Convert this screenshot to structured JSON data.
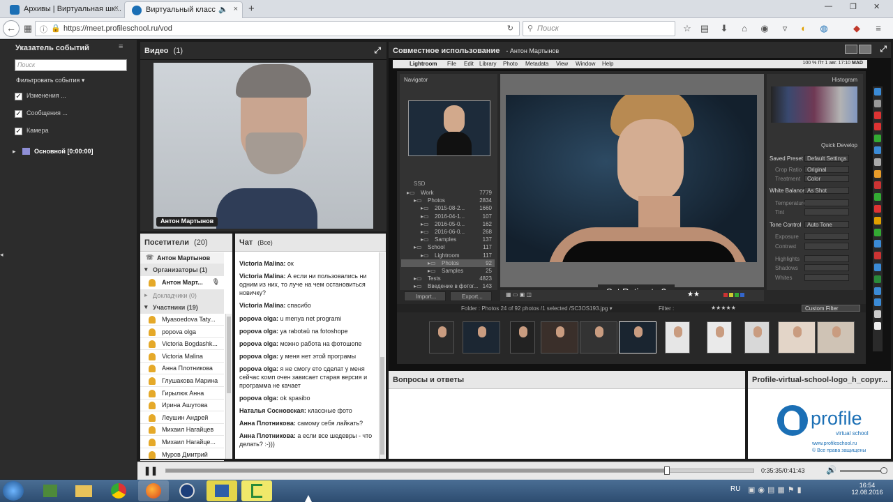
{
  "browser": {
    "tabs": [
      {
        "title": "Архивы | Виртуальная шк...",
        "close": "×"
      },
      {
        "title": "Виртуальный класс",
        "close": "×"
      }
    ],
    "new_tab": "+",
    "url": "https://meet.profileschool.ru/vod",
    "search_placeholder": "Поиск",
    "window_controls": [
      "—",
      "❐",
      "✕"
    ]
  },
  "left_panel": {
    "title": "Указатель событий",
    "menu": "≡",
    "search_placeholder": "Поиск",
    "filter_label": "Фильтровать события",
    "filters": [
      {
        "label": "Изменения ...",
        "checked": true
      },
      {
        "label": "Сообщения ...",
        "checked": true
      },
      {
        "label": "Камера",
        "checked": true
      }
    ],
    "event": "Основной [0:00:00]"
  },
  "video_pod": {
    "title": "Видео",
    "count": "(1)",
    "speaker": "Антон Мартынов"
  },
  "share_pod": {
    "title": "Совместное использование",
    "presenter": "- Антон Мартынов"
  },
  "lightroom": {
    "menubar": [
      "Lightroom",
      "File",
      "Edit",
      "Library",
      "Photo",
      "Metadata",
      "View",
      "Window",
      "Help"
    ],
    "status_right": [
      "100 %",
      "Пт",
      "1 авг.",
      "17:10",
      "MAD"
    ],
    "navigator": "Navigator",
    "histogram": "Histogram",
    "quick_develop": "Quick Develop",
    "qd_labels": [
      "Saved Preset",
      "Crop Ratio",
      "Treatment",
      "White Balance",
      "Temperature",
      "Tint",
      "Tone Control",
      "Exposure",
      "Contrast",
      "Highlights",
      "Shadows",
      "Whites"
    ],
    "qd_values": [
      "Default Settings",
      "Original",
      "Color",
      "As Shot",
      "",
      "",
      "Auto Tone",
      "",
      "",
      "",
      "",
      ""
    ],
    "folders_header": "SSD",
    "folders": [
      {
        "name": "Work",
        "count": "7779"
      },
      {
        "name": "Photos",
        "count": "2834"
      },
      {
        "name": "2015-08-2...",
        "count": "1660"
      },
      {
        "name": "2016-04-1...",
        "count": "107"
      },
      {
        "name": "2016-05-0...",
        "count": "162"
      },
      {
        "name": "2016-06-0...",
        "count": "268"
      },
      {
        "name": "Samples",
        "count": "137"
      },
      {
        "name": "School",
        "count": "117"
      },
      {
        "name": "Lightroom",
        "count": "117"
      },
      {
        "name": "Photos",
        "count": "92"
      },
      {
        "name": "Samples",
        "count": "25"
      },
      {
        "name": "Tests",
        "count": "4823"
      },
      {
        "name": "Введение в фотог...",
        "count": "143"
      }
    ],
    "import_btn": "Import...",
    "export_btn": "Export...",
    "toast": "Set Rating to 2",
    "filmstrip_info": "Folder : Photos    24 of 92 photos /1 selected /SC3OS193.jpg ▾",
    "filter_label": "Filter :",
    "custom_filter": "Custom Filter"
  },
  "attendees": {
    "title": "Посетители",
    "count": "(20)",
    "host": "Антон Мартынов",
    "organizers_label": "Организаторы (1)",
    "organizer": "Антон Март...",
    "presenters_label": "Докладчики (0)",
    "participants_label": "Участники (19)",
    "participants": [
      "Myasoedova Taty...",
      "popova olga",
      "Victoria Bogdashk...",
      "Victoria Malina",
      "Анна Плотникова",
      "Глушакова Марина",
      "Гирылюк Анна",
      "Ирина Ашутова",
      "Леушин Андрей",
      "Михаил Нагайцев",
      "Михаил Нагайце...",
      "Муров Дмитрий"
    ]
  },
  "chat": {
    "title": "Чат",
    "scope": "(Все)",
    "messages": [
      {
        "author": "Victoria Malina:",
        "text": "ок"
      },
      {
        "author": "Victoria Malina:",
        "text": "А если ни пользовались ни одним из них, то луче на чем остановиться новичку?"
      },
      {
        "author": "Victoria Malina:",
        "text": "спасибо"
      },
      {
        "author": "popova olga:",
        "text": "u menya net programi"
      },
      {
        "author": "popova olga:",
        "text": "ya rabotaü na fotoshope"
      },
      {
        "author": "popova olga:",
        "text": "можно работа на фотошопе"
      },
      {
        "author": "popova olga:",
        "text": "у меня нет этой програмы"
      },
      {
        "author": "popova olga:",
        "text": "я не смогу ето сделат у меня сейчас комп очен зависает старая версия и программа не качает"
      },
      {
        "author": "popova olga:",
        "text": "ok spasibo"
      },
      {
        "author": "Наталья Сосновская:",
        "text": "классные фото"
      },
      {
        "author": "Анна Плотникова:",
        "text": "самому себя лайкать?"
      },
      {
        "author": "Анна Плотникова:",
        "text": "а если все шедевры - что делать? :-)))"
      }
    ]
  },
  "qa": {
    "title": "Вопросы и ответы"
  },
  "logo_pod": {
    "title": "Profile-virtual-school-logo_h_copyr...",
    "brand": "profile",
    "tagline": "virtual school",
    "site": "www.profileschool.ru",
    "rights": "© Все права защищены"
  },
  "playback": {
    "time": "0:35:35/0:41:43",
    "progress": 0.853
  },
  "taskbar": {
    "lang": "RU",
    "time": "16:54",
    "date": "12.08.2016"
  },
  "colors": {
    "accent": "#1b6fb5",
    "dark_bg": "#1b1b1b",
    "panel_bg": "#2c2c2c"
  }
}
